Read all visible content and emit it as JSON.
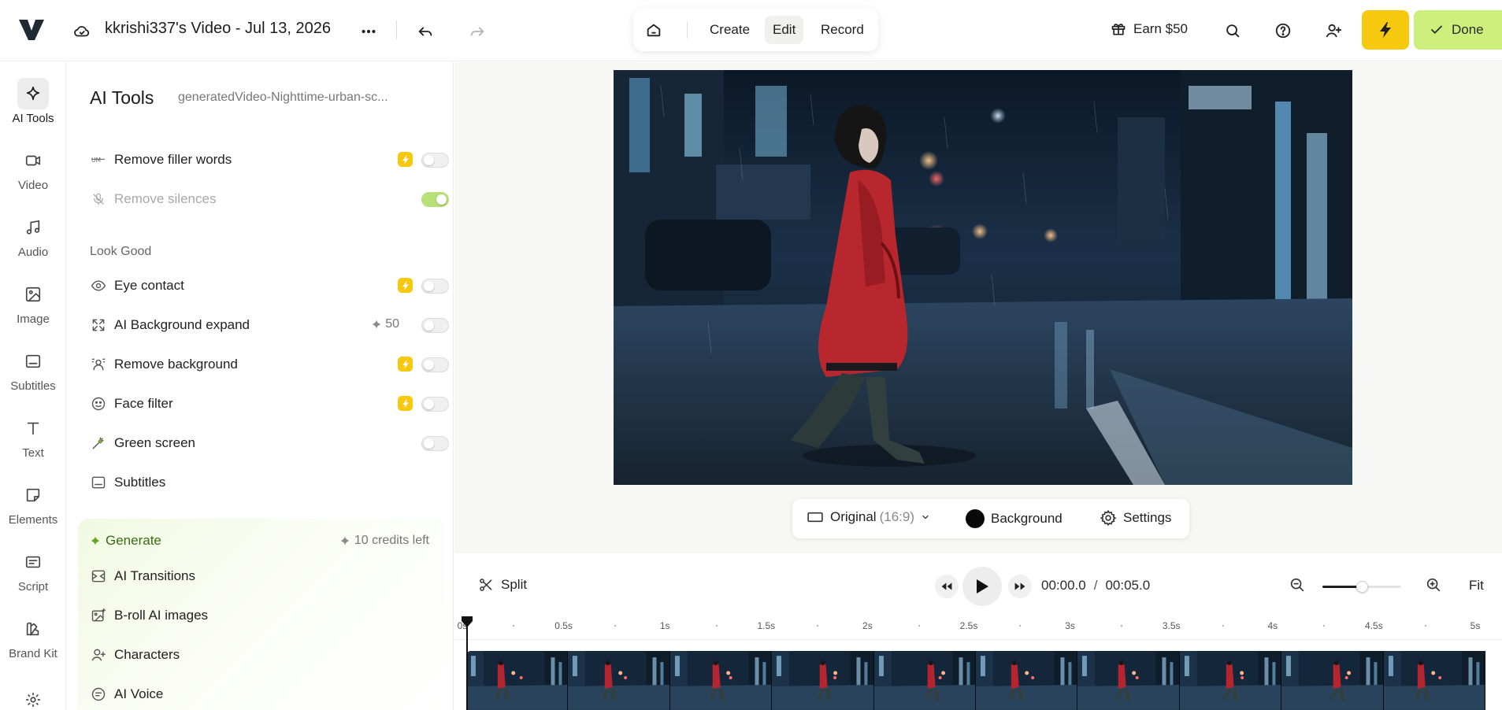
{
  "app": {
    "doc_title": "kkrishi337's Video - Jul 13, 2026",
    "modes": [
      "Create",
      "Edit",
      "Record"
    ],
    "active_mode": "Edit",
    "earn_label": "Earn $50",
    "done_label": "Done",
    "colors": {
      "upgrade": "#f6c90e",
      "done": "#cdef7b",
      "generate_accent": "#3a6b16"
    }
  },
  "rail": {
    "items": [
      {
        "label": "AI Tools",
        "icon": "sparkle-icon"
      },
      {
        "label": "Video",
        "icon": "video-icon"
      },
      {
        "label": "Audio",
        "icon": "music-note-icon"
      },
      {
        "label": "Image",
        "icon": "image-icon"
      },
      {
        "label": "Subtitles",
        "icon": "subtitles-icon"
      },
      {
        "label": "Text",
        "icon": "text-icon"
      },
      {
        "label": "Elements",
        "icon": "sticker-icon"
      },
      {
        "label": "Script",
        "icon": "script-icon"
      },
      {
        "label": "Brand Kit",
        "icon": "brand-kit-icon"
      }
    ]
  },
  "panel": {
    "title": "AI Tools",
    "subtitle": "generatedVideo-Nighttime-urban-sc...",
    "tools_top": [
      {
        "label": "Remove filler words",
        "icon": "filler-words-icon",
        "badge": "bolt",
        "toggle": false
      },
      {
        "label": "Remove silences",
        "icon": "mic-off-icon",
        "toggle": true,
        "disabled": true
      }
    ],
    "look_good_heading": "Look Good",
    "look_good": [
      {
        "label": "Eye contact",
        "icon": "eye-icon",
        "badge": "bolt",
        "toggle": false
      },
      {
        "label": "AI Background expand",
        "icon": "expand-icon",
        "cost": "50",
        "toggle": false
      },
      {
        "label": "Remove background",
        "icon": "person-remove-bg-icon",
        "badge": "bolt",
        "toggle": false
      },
      {
        "label": "Face filter",
        "icon": "face-filter-icon",
        "badge": "bolt",
        "toggle": false
      },
      {
        "label": "Green screen",
        "icon": "magic-wand-icon",
        "toggle": false
      },
      {
        "label": "Subtitles",
        "icon": "subtitles-icon"
      }
    ],
    "generate": {
      "title": "Generate",
      "credits": "10 credits left",
      "items": [
        {
          "label": "AI Transitions",
          "icon": "transitions-icon"
        },
        {
          "label": "B-roll AI images",
          "icon": "broll-image-icon"
        },
        {
          "label": "Characters",
          "icon": "add-person-icon"
        },
        {
          "label": "AI Voice",
          "icon": "voice-icon"
        }
      ]
    }
  },
  "aspect_bar": {
    "ratio_label": "Original",
    "ratio_value": "(16:9)",
    "background_label": "Background",
    "settings_label": "Settings"
  },
  "playback": {
    "split_label": "Split",
    "current_time": "00:00.0",
    "separator": "/",
    "total_time": "00:05.0",
    "fit_label": "Fit",
    "zoom_level": 0.5
  },
  "timeline": {
    "ticks": [
      "0s",
      "0.5s",
      "1s",
      "1.5s",
      "2s",
      "2.5s",
      "3s",
      "3.5s",
      "4s",
      "4.5s",
      "5s"
    ],
    "thumbnail_count": 10
  }
}
